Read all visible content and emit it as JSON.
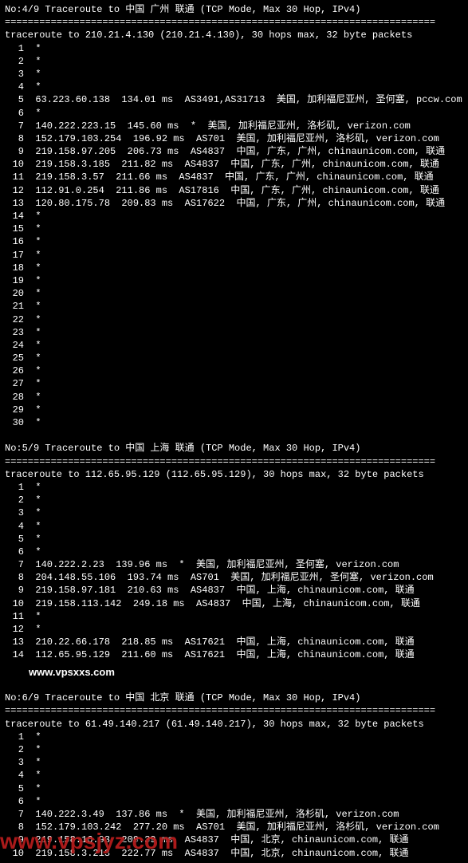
{
  "watermarks": {
    "small": "www.vpsxxs.com",
    "large": "www.vpsjyz.com"
  },
  "rule": "===========================================================================",
  "traces": [
    {
      "header": "No:4/9 Traceroute to 中国 广州 联通 (TCP Mode, Max 30 Hop, IPv4)",
      "subheader": "traceroute to 210.21.4.130 (210.21.4.130), 30 hops max, 32 byte packets",
      "hops": [
        {
          "n": 1,
          "text": "*"
        },
        {
          "n": 2,
          "text": "*"
        },
        {
          "n": 3,
          "text": "*"
        },
        {
          "n": 4,
          "text": "*"
        },
        {
          "n": 5,
          "text": "63.223.60.138  134.01 ms  AS3491,AS31713  美国, 加利福尼亚州, 圣何塞, pccw.com"
        },
        {
          "n": 6,
          "text": "*"
        },
        {
          "n": 7,
          "text": "140.222.223.15  145.60 ms  *  美国, 加利福尼亚州, 洛杉矶, verizon.com"
        },
        {
          "n": 8,
          "text": "152.179.103.254  196.92 ms  AS701  美国, 加利福尼亚州, 洛杉矶, verizon.com"
        },
        {
          "n": 9,
          "text": "219.158.97.205  206.73 ms  AS4837  中国, 广东, 广州, chinaunicom.com, 联通"
        },
        {
          "n": 10,
          "text": "219.158.3.185  211.82 ms  AS4837  中国, 广东, 广州, chinaunicom.com, 联通"
        },
        {
          "n": 11,
          "text": "219.158.3.57  211.66 ms  AS4837  中国, 广东, 广州, chinaunicom.com, 联通"
        },
        {
          "n": 12,
          "text": "112.91.0.254  211.86 ms  AS17816  中国, 广东, 广州, chinaunicom.com, 联通"
        },
        {
          "n": 13,
          "text": "120.80.175.78  209.83 ms  AS17622  中国, 广东, 广州, chinaunicom.com, 联通"
        },
        {
          "n": 14,
          "text": "*"
        },
        {
          "n": 15,
          "text": "*"
        },
        {
          "n": 16,
          "text": "*"
        },
        {
          "n": 17,
          "text": "*"
        },
        {
          "n": 18,
          "text": "*"
        },
        {
          "n": 19,
          "text": "*"
        },
        {
          "n": 20,
          "text": "*"
        },
        {
          "n": 21,
          "text": "*"
        },
        {
          "n": 22,
          "text": "*"
        },
        {
          "n": 23,
          "text": "*"
        },
        {
          "n": 24,
          "text": "*"
        },
        {
          "n": 25,
          "text": "*"
        },
        {
          "n": 26,
          "text": "*"
        },
        {
          "n": 27,
          "text": "*"
        },
        {
          "n": 28,
          "text": "*"
        },
        {
          "n": 29,
          "text": "*"
        },
        {
          "n": 30,
          "text": "*"
        }
      ]
    },
    {
      "header": "No:5/9 Traceroute to 中国 上海 联通 (TCP Mode, Max 30 Hop, IPv4)",
      "subheader": "traceroute to 112.65.95.129 (112.65.95.129), 30 hops max, 32 byte packets",
      "hops": [
        {
          "n": 1,
          "text": "*"
        },
        {
          "n": 2,
          "text": "*"
        },
        {
          "n": 3,
          "text": "*"
        },
        {
          "n": 4,
          "text": "*"
        },
        {
          "n": 5,
          "text": "*"
        },
        {
          "n": 6,
          "text": "*"
        },
        {
          "n": 7,
          "text": "140.222.2.23  139.96 ms  *  美国, 加利福尼亚州, 圣何塞, verizon.com"
        },
        {
          "n": 8,
          "text": "204.148.55.106  193.74 ms  AS701  美国, 加利福尼亚州, 圣何塞, verizon.com"
        },
        {
          "n": 9,
          "text": "219.158.97.181  210.63 ms  AS4837  中国, 上海, chinaunicom.com, 联通"
        },
        {
          "n": 10,
          "text": "219.158.113.142  249.18 ms  AS4837  中国, 上海, chinaunicom.com, 联通"
        },
        {
          "n": 11,
          "text": "*"
        },
        {
          "n": 12,
          "text": "*"
        },
        {
          "n": 13,
          "text": "210.22.66.178  218.85 ms  AS17621  中国, 上海, chinaunicom.com, 联通"
        },
        {
          "n": 14,
          "text": "112.65.95.129  211.60 ms  AS17621  中国, 上海, chinaunicom.com, 联通"
        }
      ]
    },
    {
      "header": "No:6/9 Traceroute to 中国 北京 联通 (TCP Mode, Max 30 Hop, IPv4)",
      "subheader": "traceroute to 61.49.140.217 (61.49.140.217), 30 hops max, 32 byte packets",
      "hops": [
        {
          "n": 1,
          "text": "*"
        },
        {
          "n": 2,
          "text": "*"
        },
        {
          "n": 3,
          "text": "*"
        },
        {
          "n": 4,
          "text": "*"
        },
        {
          "n": 5,
          "text": "*"
        },
        {
          "n": 6,
          "text": "*"
        },
        {
          "n": 7,
          "text": "140.222.3.49  137.86 ms  *  美国, 加利福尼亚州, 洛杉矶, verizon.com"
        },
        {
          "n": 8,
          "text": "152.179.103.242  277.20 ms  AS701  美国, 加利福尼亚州, 洛杉矶, verizon.com"
        },
        {
          "n": 9,
          "text": "219.158.16.93  209.39 ms  AS4837  中国, 北京, chinaunicom.com, 联通"
        },
        {
          "n": 10,
          "text": "219.158.3.213  222.77 ms  AS4837  中国, 北京, chinaunicom.com, 联通"
        }
      ]
    }
  ]
}
